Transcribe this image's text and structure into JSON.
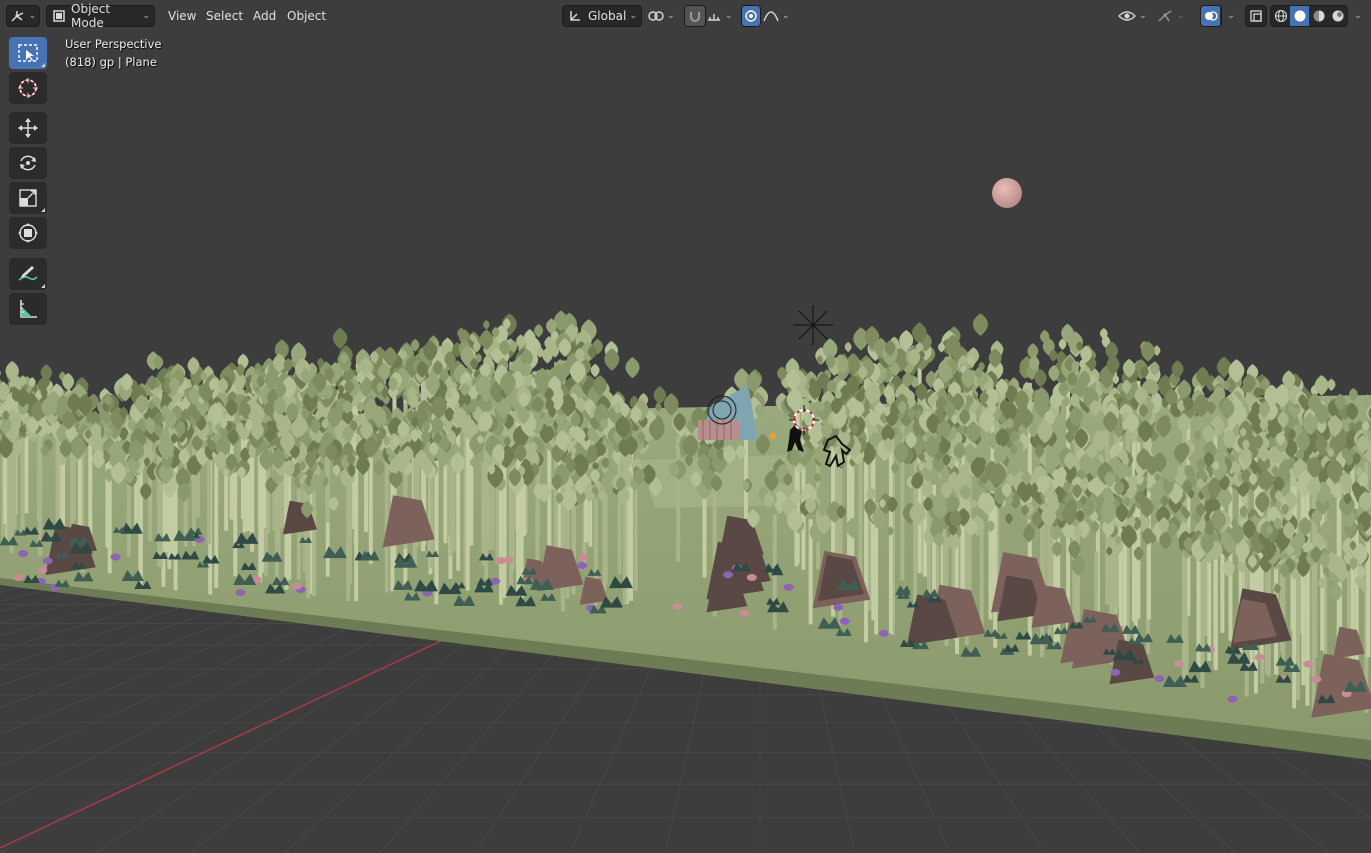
{
  "header": {
    "mode": "Object Mode",
    "menus": [
      "View",
      "Select",
      "Add",
      "Object"
    ],
    "transform_orientation": "Global"
  },
  "viewport": {
    "perspective_label": "User Perspective",
    "object_info": "(818) gp | Plane"
  },
  "toolbar": {
    "tools": [
      "select-box-icon",
      "cursor-icon",
      "move-icon",
      "rotate-icon",
      "scale-icon",
      "transform-icon",
      "annotate-icon",
      "measure-icon"
    ],
    "active": "select-box-icon"
  },
  "colors": {
    "viewport_bg": "#3d3d3d",
    "grid": "#474747",
    "x_axis": "#a83a46",
    "ground": "#8e9e72",
    "foliage": "#8b9a6d",
    "accent": "#4772b3"
  },
  "shading": {
    "modes": [
      "wireframe-icon",
      "solid-icon",
      "material-icon",
      "rendered-icon"
    ],
    "active": "solid-icon"
  }
}
